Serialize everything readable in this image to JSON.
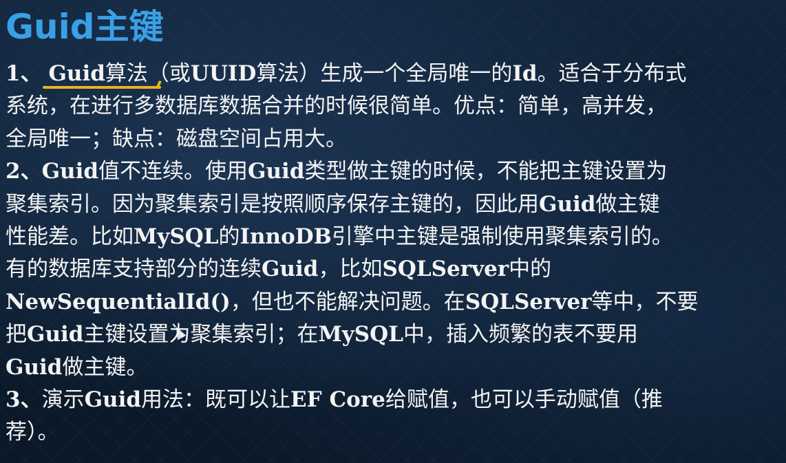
{
  "title": "Guid主键",
  "points": {
    "p1": {
      "num": "1、",
      "guid": "Guid",
      "a": "算法（或",
      "uuid": "UUID",
      "b": "算法）生成一个全局唯一的",
      "id": "Id",
      "c": "。适合于分布式",
      "line2": "系统，在进行多数据库数据合并的时候很简单。优点：简单，高并发，",
      "line3": "全局唯一；缺点：磁盘空间占用大。"
    },
    "p2": {
      "num": "2、",
      "g1": "Guid",
      "a": "值不连续。使用",
      "g2": "Guid",
      "b": "类型做主键的时候，不能把主键设置为",
      "line2": "聚集索引。因为聚集索引是按照顺序保存主键的，因此用",
      "g3": "Guid",
      "c": "做主键",
      "d": "性能差。比如",
      "mysql": "MySQL",
      "e": "的",
      "innodb": "InnoDB",
      "f": "引擎中主键是强制使用聚集索引的。",
      "g": "有的数据库支持部分的连续",
      "g4": "Guid",
      "h": "，比如",
      "sqlserver": "SQLServer",
      "i": "中的",
      "newseq": "NewSequentialId()",
      "j": "，但也不能解决问题。在",
      "sqlserver2": "SQLServer",
      "k": "等中，不要",
      "l": "把",
      "g5": "Guid",
      "m": "主键设置为聚集索引；在",
      "mysql2": "MySQL",
      "n": "中，插入频繁的表不要用",
      "g6": "Guid",
      "o": "做主键。"
    },
    "p3": {
      "num": "3、",
      "a": "演示",
      "guid": "Guid",
      "b": "用法：既可以让",
      "efcore": "EF Core",
      "c": "给赋值，也可以手动赋值（推",
      "d": "荐）。"
    }
  },
  "colors": {
    "title": "#3aa0e6",
    "text": "#f3f3f3",
    "underline": "#e8b41c",
    "background": "#0d1e31"
  }
}
